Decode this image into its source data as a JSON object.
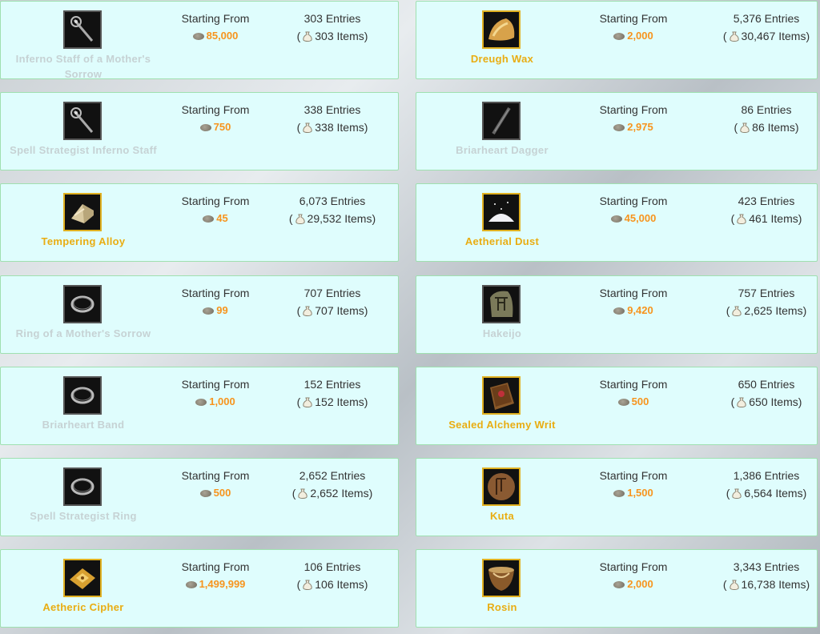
{
  "label_starting_from": "Starting From",
  "label_paren_open": "(",
  "colors": {
    "price": "#f7941d",
    "name_gold": "#e9ad12",
    "name_gray": "#c6d2d4",
    "card_bg": "#dffdfd",
    "card_border": "#9fe0b0"
  },
  "items": [
    {
      "name": "Inferno Staff of a Mother's Sorrow",
      "price": "85,000",
      "entries": "303 Entries",
      "items": "303 Items)",
      "icon": "staff-icon"
    },
    {
      "name": "Dreugh Wax",
      "price": "2,000",
      "entries": "5,376 Entries",
      "items": "30,467 Items)",
      "icon": "wax-icon"
    },
    {
      "name": "Spell Strategist Inferno Staff",
      "price": "750",
      "entries": "338 Entries",
      "items": "338 Items)",
      "icon": "staff-icon"
    },
    {
      "name": "Briarheart Dagger",
      "price": "2,975",
      "entries": "86 Entries",
      "items": "86 Items)",
      "icon": "dagger-icon"
    },
    {
      "name": "Tempering Alloy",
      "price": "45",
      "entries": "6,073 Entries",
      "items": "29,532 Items)",
      "icon": "alloy-icon"
    },
    {
      "name": "Aetherial Dust",
      "price": "45,000",
      "entries": "423 Entries",
      "items": "461 Items)",
      "icon": "dust-icon"
    },
    {
      "name": "Ring of a Mother's Sorrow",
      "price": "99",
      "entries": "707 Entries",
      "items": "707 Items)",
      "icon": "ring-icon"
    },
    {
      "name": "Hakeijo",
      "price": "9,420",
      "entries": "757 Entries",
      "items": "2,625 Items)",
      "icon": "rune-stone-icon"
    },
    {
      "name": "Briarheart Band",
      "price": "1,000",
      "entries": "152 Entries",
      "items": "152 Items)",
      "icon": "ring-icon"
    },
    {
      "name": "Sealed Alchemy Writ",
      "price": "500",
      "entries": "650 Entries",
      "items": "650 Items)",
      "icon": "writ-icon"
    },
    {
      "name": "Spell Strategist Ring",
      "price": "500",
      "entries": "2,652 Entries",
      "items": "2,652 Items)",
      "icon": "ring-icon"
    },
    {
      "name": "Kuta",
      "price": "1,500",
      "entries": "1,386 Entries",
      "items": "6,564 Items)",
      "icon": "rune-round-icon"
    },
    {
      "name": "Aetheric Cipher",
      "price": "1,499,999",
      "entries": "106 Entries",
      "items": "106 Items)",
      "icon": "cipher-icon"
    },
    {
      "name": "Rosin",
      "price": "2,000",
      "entries": "3,343 Entries",
      "items": "16,738 Items)",
      "icon": "rosin-icon"
    }
  ]
}
